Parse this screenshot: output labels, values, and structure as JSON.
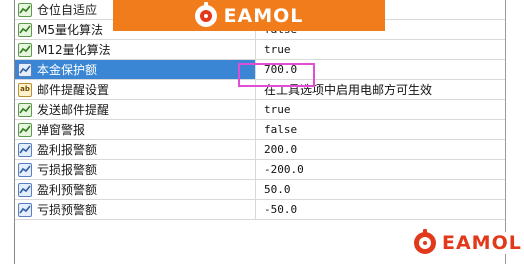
{
  "parameters": [
    {
      "name": "仓位自适应",
      "value": "",
      "icon": "bool-parameter-icon",
      "kind": "bool"
    },
    {
      "name": "M5量化算法",
      "value": "false",
      "icon": "bool-parameter-icon",
      "kind": "bool"
    },
    {
      "name": "M12量化算法",
      "value": "true",
      "icon": "bool-parameter-icon",
      "kind": "bool"
    },
    {
      "name": "本金保护额",
      "value": "700.0",
      "icon": "number-parameter-icon",
      "kind": "num",
      "selected": true
    },
    {
      "name": "邮件提醒设置",
      "value": "在工具选项中启用电邮方可生效",
      "icon": "text-parameter-icon",
      "kind": "text"
    },
    {
      "name": "发送邮件提醒",
      "value": "true",
      "icon": "bool-parameter-icon",
      "kind": "bool"
    },
    {
      "name": "弹窗警报",
      "value": "false",
      "icon": "bool-parameter-icon",
      "kind": "bool"
    },
    {
      "name": "盈利报警额",
      "value": "200.0",
      "icon": "number-parameter-icon",
      "kind": "num"
    },
    {
      "name": "亏损报警额",
      "value": "-200.0",
      "icon": "number-parameter-icon",
      "kind": "num"
    },
    {
      "name": "盈利预警额",
      "value": "50.0",
      "icon": "number-parameter-icon",
      "kind": "num"
    },
    {
      "name": "亏损预警额",
      "value": "-50.0",
      "icon": "number-parameter-icon",
      "kind": "num"
    }
  ],
  "banner": {
    "logo_text": "EAMOL",
    "logo_icon": "eamol-logo-icon",
    "color": "#f07c1c"
  },
  "watermark": {
    "logo_text": "EAMOL",
    "logo_icon": "eamol-logo-icon",
    "color": "#e2391b"
  },
  "colors": {
    "selection": "#3b86d4",
    "highlight_box": "#e04fd3"
  },
  "icon_labels": {
    "text": "ab"
  }
}
